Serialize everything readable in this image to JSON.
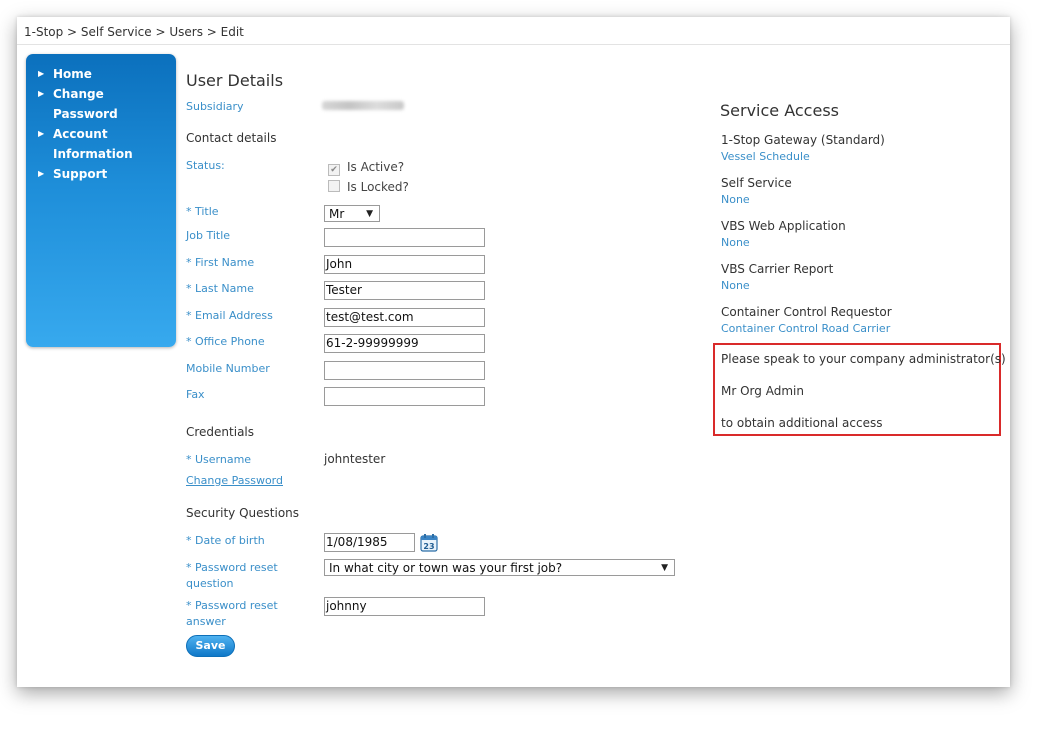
{
  "breadcrumb": "1-Stop > Self Service > Users > Edit",
  "sidebar": {
    "items": [
      {
        "label": "Home"
      },
      {
        "label": "Change Password"
      },
      {
        "label": "Account Information"
      },
      {
        "label": "Support"
      }
    ]
  },
  "form": {
    "title": "User Details",
    "subsidiary_label": "Subsidiary",
    "contact_heading": "Contact details",
    "status_label": "Status:",
    "is_active_label": "Is Active?",
    "is_active_checked": true,
    "is_locked_label": "Is Locked?",
    "is_locked_checked": false,
    "title_label": "* Title",
    "title_value": "Mr",
    "job_title_label": "Job Title",
    "job_title_value": "",
    "first_name_label": "* First Name",
    "first_name_value": "John",
    "last_name_label": "* Last Name",
    "last_name_value": "Tester",
    "email_label": "* Email Address",
    "email_value": "test@test.com",
    "office_phone_label": "* Office Phone",
    "office_phone_value": "61-2-99999999",
    "mobile_label": "Mobile Number",
    "mobile_value": "",
    "fax_label": "Fax",
    "fax_value": "",
    "credentials_heading": "Credentials",
    "username_label": "* Username",
    "username_value": "johntester",
    "change_password_link": "Change Password",
    "security_heading": "Security Questions",
    "dob_label": "* Date of birth",
    "dob_value": "1/08/1985",
    "calendar_day": "23",
    "reset_question_label_1": "* Password reset",
    "reset_question_label_2": "question",
    "reset_question_value": "In what city or town was your first job?",
    "reset_answer_label_1": "* Password reset",
    "reset_answer_label_2": "answer",
    "reset_answer_value": "johnny",
    "save_label": "Save"
  },
  "service_access": {
    "heading": "Service Access",
    "services": [
      {
        "name": "1-Stop Gateway (Standard)",
        "value": "Vessel Schedule"
      },
      {
        "name": "Self Service",
        "value": "None"
      },
      {
        "name": "VBS Web Application",
        "value": "None"
      },
      {
        "name": "VBS Carrier Report",
        "value": "None"
      },
      {
        "name": "Container Control Requestor",
        "value": "Container Control Road Carrier"
      }
    ],
    "admin_note_1": "Please speak to your company administrator(s)",
    "admin_name": "Mr Org Admin",
    "admin_note_2": "to obtain additional access"
  },
  "colors": {
    "accent_blue": "#3a8fc9",
    "sidebar_blue": "#1e8ed9",
    "highlight_red": "#d92a2a"
  }
}
